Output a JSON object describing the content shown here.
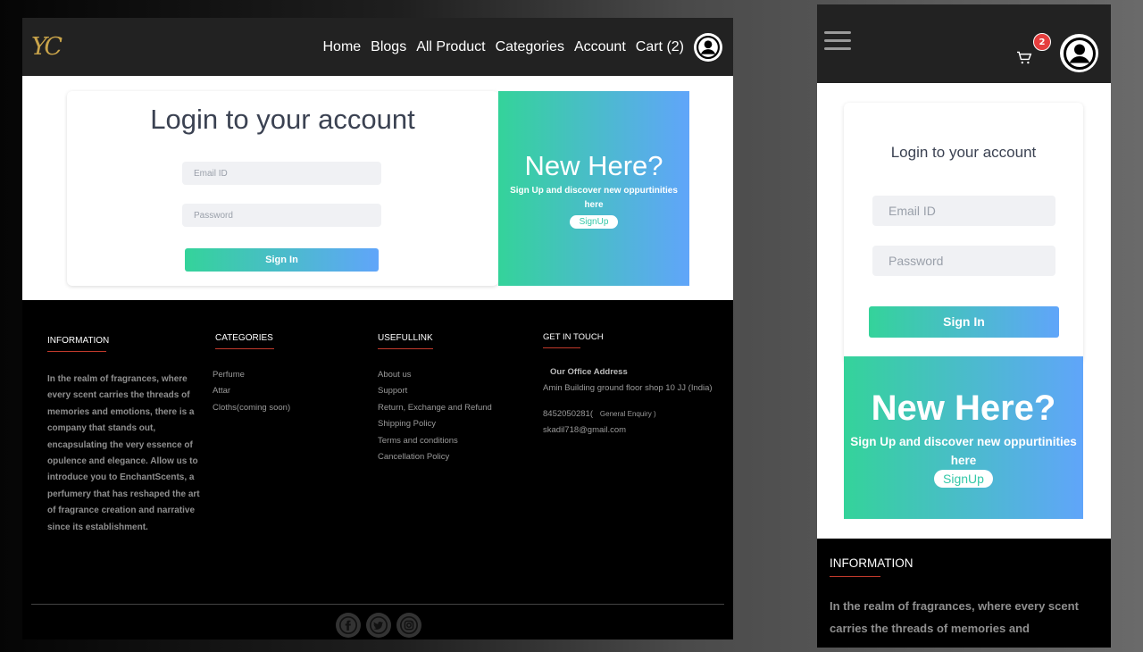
{
  "desktop": {
    "logo": "YC",
    "nav": [
      "Home",
      "Blogs",
      "All Product",
      "Categories",
      "Account",
      "Cart (2)"
    ],
    "login": {
      "title": "Login to your account",
      "email_placeholder": "Email ID",
      "password_placeholder": "Password",
      "signin_label": "Sign In"
    },
    "newhere": {
      "title": "New Here?",
      "subtitle": "Sign Up and discover new oppurtinities here",
      "signup_label": "SignUp"
    },
    "footer": {
      "information": {
        "heading": "INFORMATION",
        "text": "In the realm of fragrances, where every scent carries the threads of memories and emotions, there is a company that stands out, encapsulating the very essence of opulence and elegance. Allow us to introduce you to EnchantScents, a perfumery that has reshaped the art of fragrance creation and narrative since its establishment."
      },
      "categories": {
        "heading": "CATEGORIES",
        "items": [
          "Perfume",
          "Attar",
          "Cloths(coming soon)"
        ]
      },
      "usefullink": {
        "heading": "USEFULLINK",
        "items": [
          "About us",
          "Support",
          "Return, Exchange and Refund",
          "Shipping Policy",
          "Terms and conditions",
          "Cancellation Policy"
        ]
      },
      "contact": {
        "heading": "GET IN TOUCH",
        "office_label": "Our Office Address",
        "address": "Amin Building ground floor shop 10 JJ (India)",
        "phone": "8452050281(",
        "enquiry": "General Enquiry )",
        "email": "skadil718@gmail.com"
      }
    },
    "socials": [
      "facebook-icon",
      "twitter-icon",
      "instagram-icon"
    ]
  },
  "mobile": {
    "cart_count": "2",
    "login": {
      "title": "Login to your account",
      "email_placeholder": "Email ID",
      "password_placeholder": "Password",
      "signin_label": "Sign In"
    },
    "newhere": {
      "title": "New Here?",
      "subtitle": "Sign Up and discover new oppurtinities here",
      "signup_label": "SignUp"
    },
    "information": {
      "heading": "INFORMATION",
      "text": "In the realm of fragrances, where every scent carries the threads of memories and"
    }
  },
  "colors": {
    "gradient_start": "#34d39a",
    "gradient_end": "#60a5fa",
    "navbar": "#222222",
    "accent_line": "#c0392b",
    "badge": "#e53e3e",
    "logo_gold": "#c9a44a"
  }
}
